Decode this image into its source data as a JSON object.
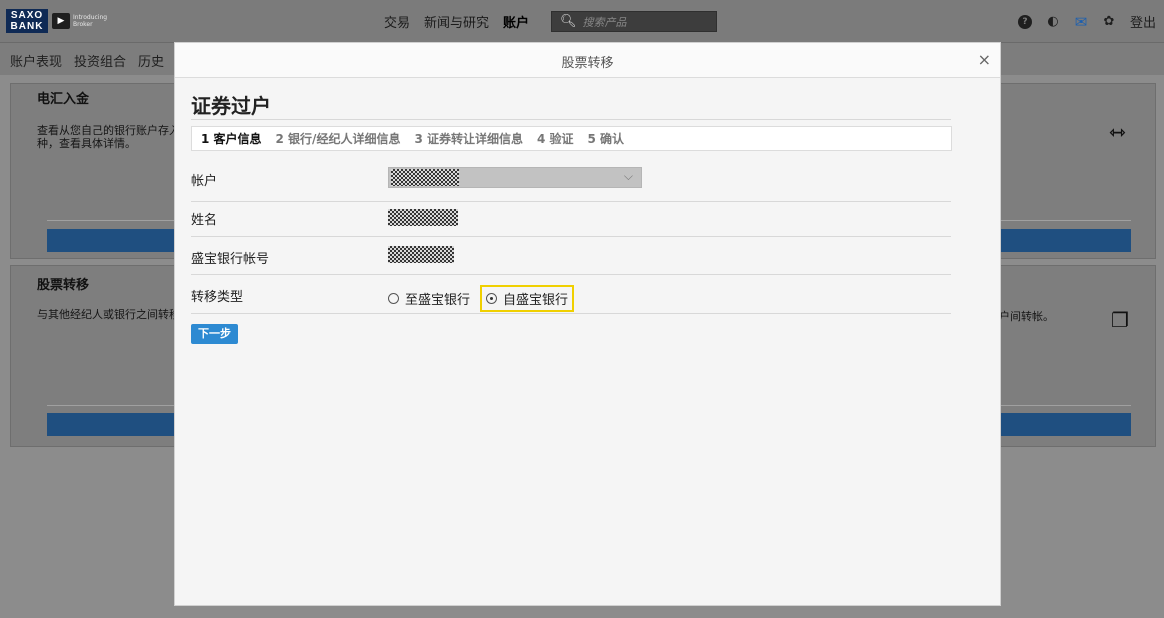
{
  "header": {
    "logo_line1": "SAXO",
    "logo_line2": "BANK",
    "ib_line1": "Introducing",
    "ib_line2": "Broker",
    "nav": [
      "交易",
      "新闻与研究",
      "账户"
    ],
    "search_placeholder": "搜索产品",
    "help_icon_text": "?",
    "logout": "登出"
  },
  "subnav": {
    "items": [
      "账户表现",
      "投资组合",
      "历史"
    ]
  },
  "cards": {
    "deposit": {
      "title": "电汇入金",
      "desc_line1": "查看从您自己的银行账户存入",
      "desc_line2": "种，查看具体详情。"
    },
    "transfer": {
      "title": "股票转移",
      "desc": "与其他经纪人或银行之间转移",
      "right_text": "户间转帐。"
    }
  },
  "modal": {
    "title": "股票转移",
    "heading": "证券过户",
    "close_label": "×",
    "steps": [
      "1 客户信息",
      "2 银行/经纪人详细信息",
      "3 证券转让详细信息",
      "4 验证",
      "5 确认"
    ],
    "fields": {
      "account_label": "帐户",
      "name_label": "姓名",
      "bank_account_label": "盛宝银行帐号",
      "transfer_type_label": "转移类型"
    },
    "transfer_options": {
      "to_saxo": "至盛宝银行",
      "from_saxo": "自盛宝银行",
      "selected": "自盛宝银行"
    },
    "next_button": "下一步"
  },
  "colors": {
    "accent": "#2d8ad2",
    "highlight": "#f0d000",
    "brand": "#0f2a55"
  }
}
